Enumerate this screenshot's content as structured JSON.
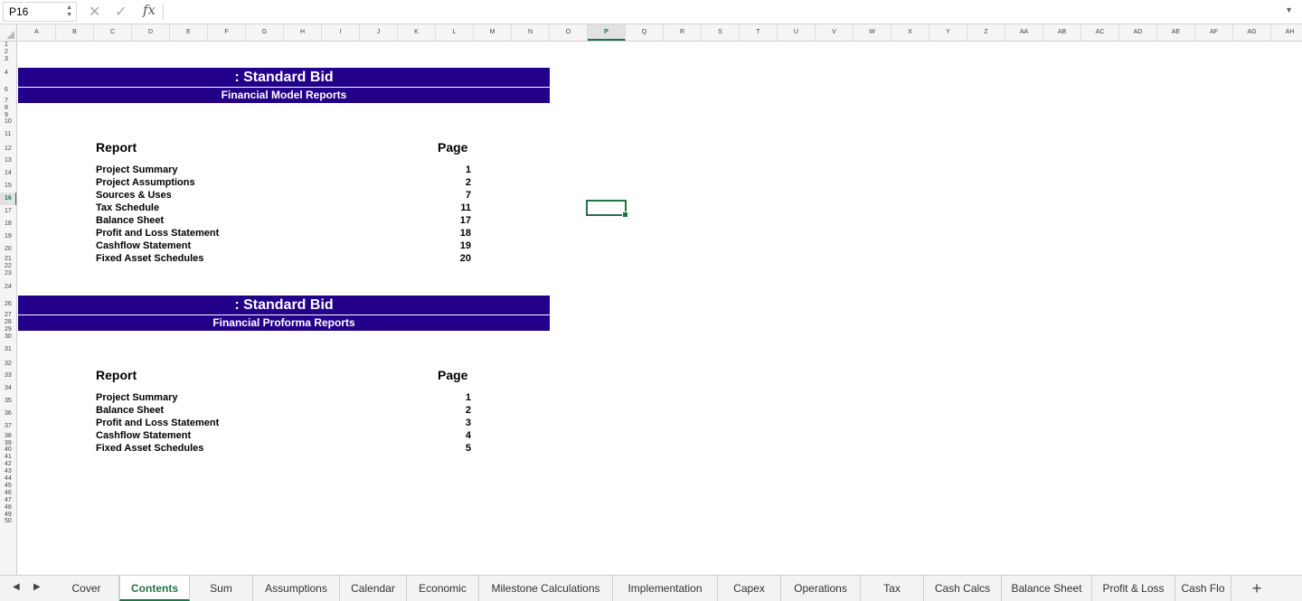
{
  "formula_bar": {
    "cell_ref": "P16",
    "cancel_icon": "✕",
    "enter_icon": "✓",
    "fx_label": "fx",
    "formula": ""
  },
  "columns": [
    "A",
    "B",
    "C",
    "D",
    "E",
    "F",
    "G",
    "H",
    "I",
    "J",
    "K",
    "L",
    "M",
    "N",
    "O",
    "P",
    "Q",
    "R",
    "S",
    "T",
    "U",
    "V",
    "W",
    "X",
    "Y",
    "Z",
    "AA",
    "AB",
    "AC",
    "AD",
    "AE",
    "AF",
    "AG",
    "AH"
  ],
  "selected_column": "P",
  "rows": [
    "1",
    "2",
    "3",
    "4",
    "6",
    "7",
    "8",
    "9",
    "10",
    "11",
    "12",
    "13",
    "14",
    "15",
    "16",
    "17",
    "18",
    "19",
    "20",
    "21",
    "22",
    "23",
    "24",
    "26",
    "27",
    "28",
    "29",
    "30",
    "31",
    "32",
    "33",
    "34",
    "35",
    "36",
    "37",
    "38",
    "39",
    "40",
    "41",
    "42",
    "43",
    "44",
    "45",
    "46",
    "47",
    "48",
    "49",
    "50"
  ],
  "selected_row": "16",
  "section1": {
    "title": ": Standard Bid",
    "subtitle": "Financial Model Reports",
    "report_header": "Report",
    "page_header": "Page",
    "items": [
      {
        "name": "Project Summary",
        "page": "1"
      },
      {
        "name": "Project Assumptions",
        "page": "2"
      },
      {
        "name": "Sources & Uses",
        "page": "7"
      },
      {
        "name": "Tax Schedule",
        "page": "11"
      },
      {
        "name": "Balance Sheet",
        "page": "17"
      },
      {
        "name": "Profit and Loss Statement",
        "page": "18"
      },
      {
        "name": "Cashflow Statement",
        "page": "19"
      },
      {
        "name": "Fixed Asset Schedules",
        "page": "20"
      }
    ]
  },
  "section2": {
    "title": ": Standard Bid",
    "subtitle": "Financial Proforma Reports",
    "report_header": "Report",
    "page_header": "Page",
    "items": [
      {
        "name": "Project Summary",
        "page": "1"
      },
      {
        "name": "Balance Sheet",
        "page": "2"
      },
      {
        "name": "Profit and Loss Statement",
        "page": "3"
      },
      {
        "name": "Cashflow Statement",
        "page": "4"
      },
      {
        "name": "Fixed Asset Schedules",
        "page": "5"
      }
    ]
  },
  "sheet_tabs": [
    "Cover",
    "Contents",
    "Sum",
    "Assumptions",
    "Calendar",
    "Economic",
    "Milestone Calculations",
    "Implementation",
    "Capex",
    "Operations",
    "Tax",
    "Cash Calcs",
    "Balance Sheet",
    "Profit & Loss",
    "Cash Flo"
  ],
  "active_tab": "Contents",
  "add_tab_label": "+",
  "colors": {
    "banner": "#22008a",
    "accent": "#217346"
  }
}
